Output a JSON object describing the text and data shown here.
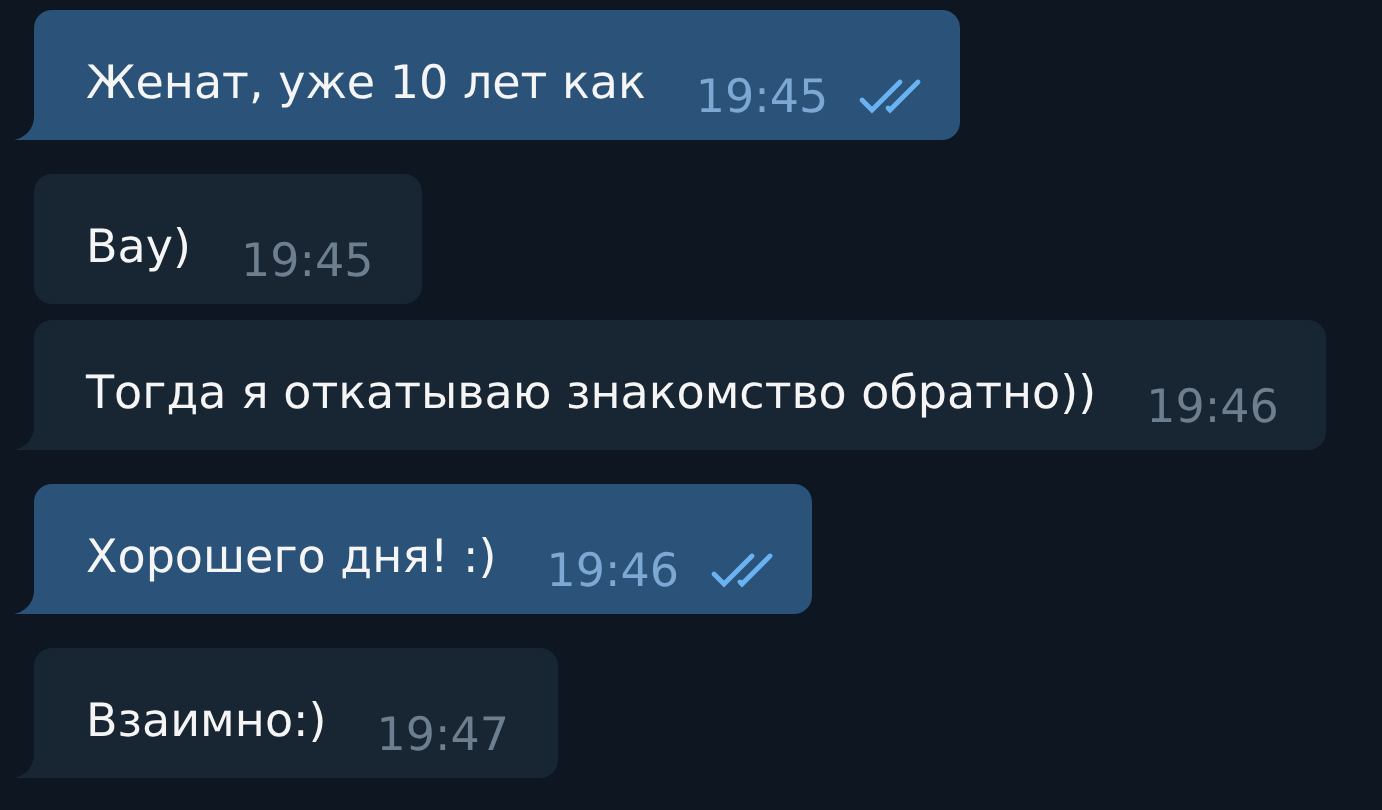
{
  "messages": [
    {
      "kind": "outgoing",
      "text": "Женат, уже 10 лет как",
      "time": "19:45",
      "read": true,
      "tail": true
    },
    {
      "kind": "incoming",
      "text": "Вау)",
      "time": "19:45",
      "tail": false
    },
    {
      "kind": "incoming",
      "text": "Тогда я откатываю знакомство обратно))",
      "time": "19:46",
      "tail": true
    },
    {
      "kind": "outgoing",
      "text": "Хорошего дня! :)",
      "time": "19:46",
      "read": true,
      "tail": true
    },
    {
      "kind": "incoming",
      "text": "Взаимно:)",
      "time": "19:47",
      "tail": true
    }
  ]
}
